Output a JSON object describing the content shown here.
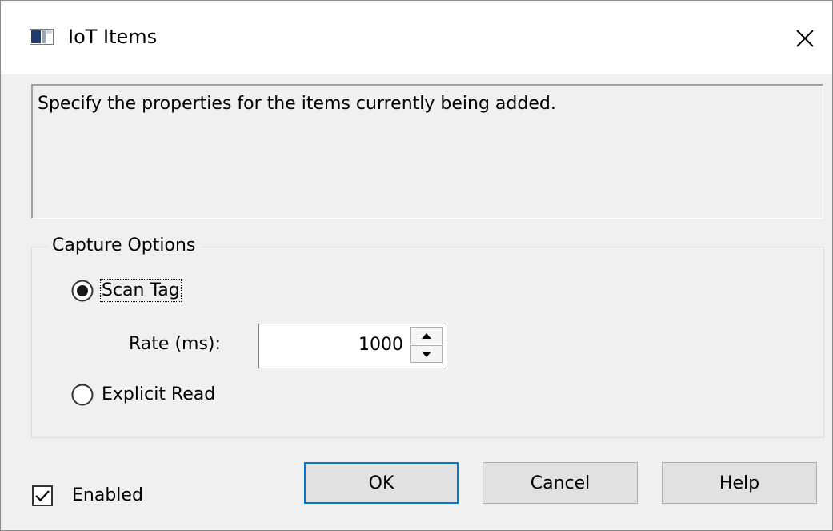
{
  "window": {
    "title": "IoT Items",
    "title_icon": "window-app-icon",
    "close_icon": "close-icon"
  },
  "description": {
    "text": "Specify the properties for the items currently being added."
  },
  "capture_options": {
    "legend": "Capture Options",
    "scan_tag": {
      "label": "Scan Tag",
      "selected": true
    },
    "rate": {
      "label": "Rate (ms):",
      "value": "1000"
    },
    "explicit_read": {
      "label": "Explicit Read",
      "selected": false
    }
  },
  "enabled": {
    "label": "Enabled",
    "checked": true
  },
  "buttons": {
    "ok": "OK",
    "cancel": "Cancel",
    "help": "Help"
  },
  "colors": {
    "dialog_background": "#f0f0f0",
    "title_background": "#ffffff",
    "default_button_border": "#0078d7",
    "button_background": "#e1e1e1"
  }
}
